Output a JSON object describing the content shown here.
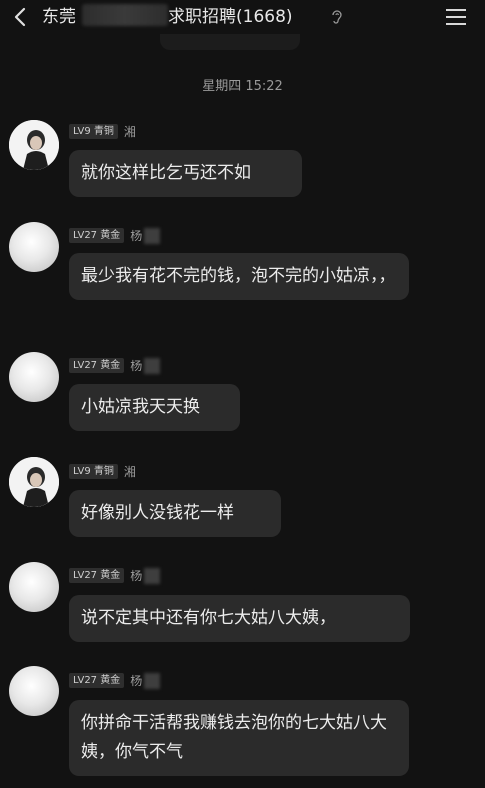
{
  "header": {
    "title_prefix": "东莞",
    "title_suffix": "求职招聘(1668)",
    "back_icon": "chevron-left-icon",
    "ear_icon": "ear-icon",
    "menu_icon": "hamburger-menu-icon"
  },
  "timestamp": "星期四 15:22",
  "messages": [
    {
      "level": "LV9 青铜",
      "name": "湘",
      "text": "就你这样比乞丐还不如"
    },
    {
      "level": "LV27 黄金",
      "name": "杨",
      "text": "最少我有花不完的钱，泡不完的小姑凉，，"
    },
    {
      "level": "LV27 黄金",
      "name": "杨",
      "text": "小姑凉我天天换"
    },
    {
      "level": "LV9 青铜",
      "name": "湘",
      "text": "好像别人没钱花一样"
    },
    {
      "level": "LV27 黄金",
      "name": "杨",
      "text": "说不定其中还有你七大姑八大姨，"
    },
    {
      "level": "LV27 黄金",
      "name": "杨",
      "text": "你拼命干活帮我赚钱去泡你的七大姑八大姨，你气不气"
    }
  ]
}
